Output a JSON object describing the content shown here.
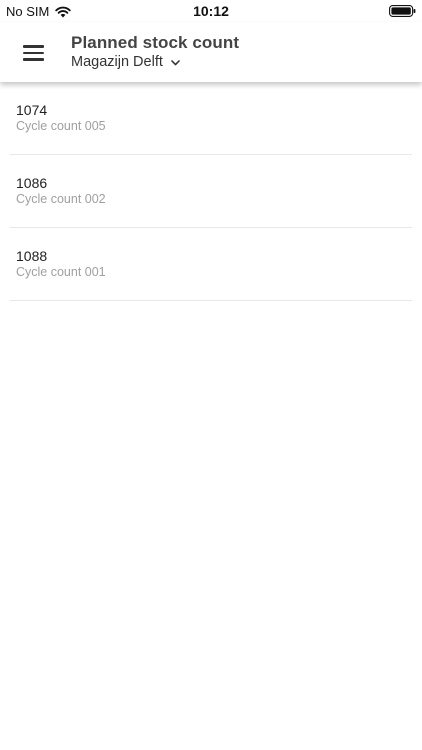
{
  "status_bar": {
    "carrier": "No SIM",
    "time": "10:12",
    "icons": [
      "wifi-icon",
      "battery-icon"
    ]
  },
  "header": {
    "title": "Planned stock count",
    "location": "Magazijn Delft",
    "icons": [
      "menu-icon",
      "chevron-down-icon"
    ]
  },
  "counts": [
    {
      "number": "1074",
      "name": "Cycle count 005"
    },
    {
      "number": "1086",
      "name": "Cycle count 002"
    },
    {
      "number": "1088",
      "name": "Cycle count 001"
    }
  ],
  "colors": {
    "background": "#ffffff",
    "title": "#444444",
    "subtitle": "#a0a0a0",
    "divider": "#e8e8e8"
  }
}
